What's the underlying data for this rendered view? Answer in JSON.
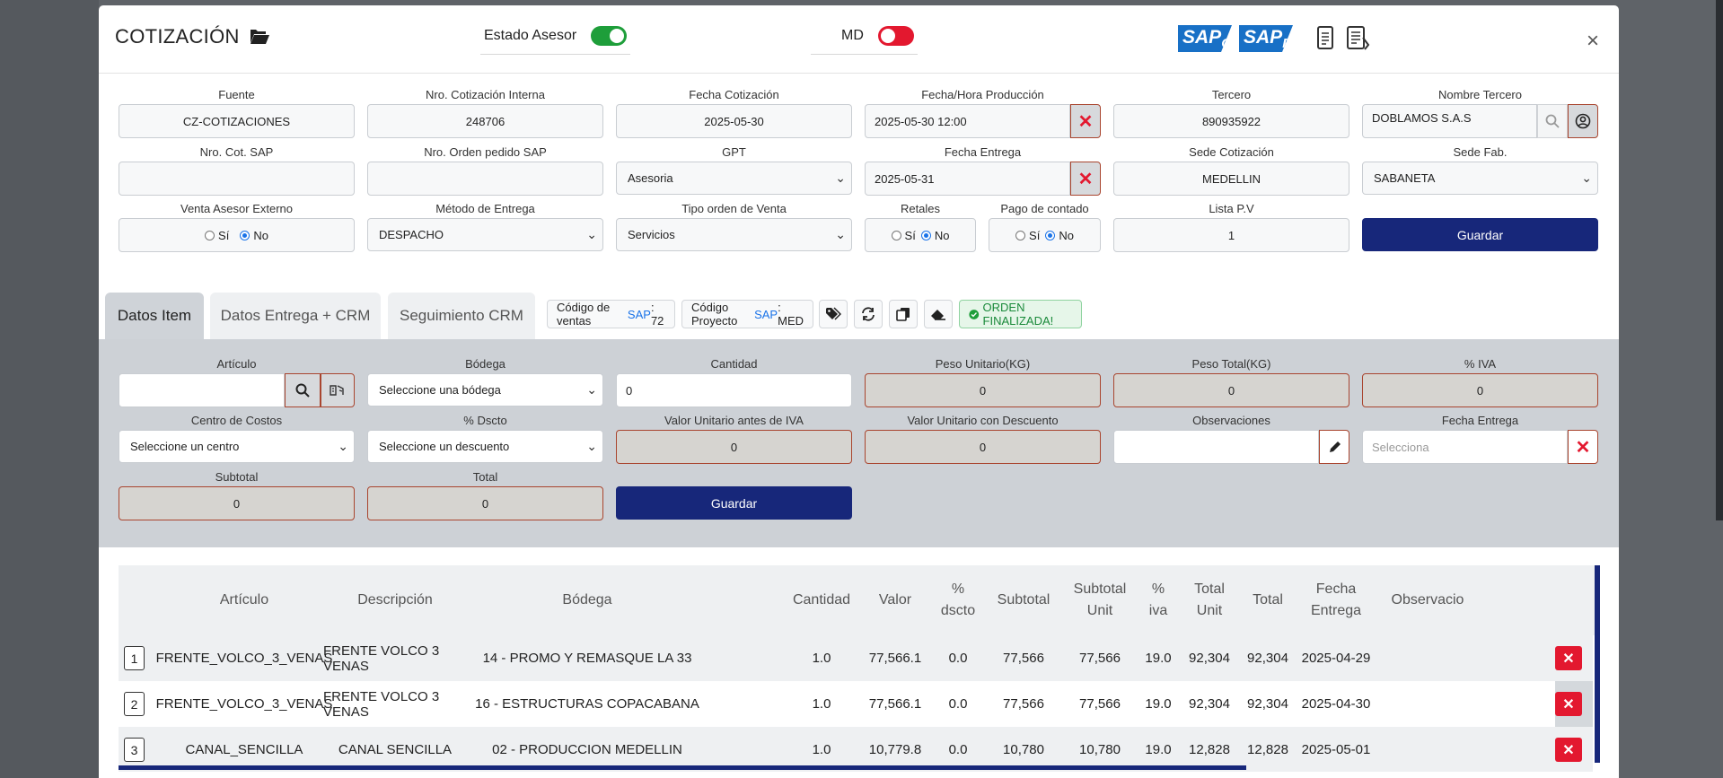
{
  "modal": {
    "title": "COTIZACIÓN",
    "estado_asesor_label": "Estado Asesor",
    "md_label": "MD",
    "close_label": "×"
  },
  "colors": {
    "primary": "#17277a",
    "danger": "#e3182f",
    "success": "#1e9e3a",
    "sap_blue": "#1870c6"
  },
  "form": {
    "fuente": {
      "label": "Fuente",
      "value": "CZ-COTIZACIONES"
    },
    "nro_cot_interna": {
      "label": "Nro. Cotización Interna",
      "value": "248706"
    },
    "fecha_cot": {
      "label": "Fecha Cotización",
      "value": "2025-05-30"
    },
    "fecha_prod": {
      "label": "Fecha/Hora Producción",
      "value": "2025-05-30 12:00"
    },
    "tercero": {
      "label": "Tercero",
      "value": "890935922"
    },
    "nombre_tercero": {
      "label": "Nombre Tercero",
      "value": "DOBLAMOS S.A.S"
    },
    "nro_cot_sap": {
      "label": "Nro. Cot. SAP",
      "value": ""
    },
    "nro_orden_sap": {
      "label": "Nro. Orden pedido SAP",
      "value": ""
    },
    "gpt": {
      "label": "GPT",
      "value": "Asesoria"
    },
    "fecha_entrega": {
      "label": "Fecha Entrega",
      "value": "2025-05-31"
    },
    "sede_cot": {
      "label": "Sede Cotización",
      "value": "MEDELLIN"
    },
    "sede_fab": {
      "label": "Sede Fab.",
      "value": "SABANETA"
    },
    "venta_asesor": {
      "label": "Venta Asesor Externo",
      "si": "Sí",
      "no": "No"
    },
    "metodo_entrega": {
      "label": "Método de Entrega",
      "value": "DESPACHO"
    },
    "tipo_orden": {
      "label": "Tipo orden de Venta",
      "value": "Servicios"
    },
    "retales": {
      "label": "Retales",
      "si": "Sí",
      "no": "No"
    },
    "pago_contado": {
      "label": "Pago de contado",
      "si": "Sí",
      "no": "No"
    },
    "lista_pv": {
      "label": "Lista P.V",
      "value": "1"
    },
    "guardar": "Guardar"
  },
  "tabs": [
    {
      "label": "Datos Item"
    },
    {
      "label": "Datos Entrega + CRM"
    },
    {
      "label": "Seguimiento CRM"
    }
  ],
  "pills": {
    "cod_ventas_prefix": "Código de ventas",
    "cod_ventas_sap": "SAP",
    "cod_ventas_value": ": 72",
    "cod_proy_prefix": "Código Proyecto",
    "cod_proy_sap": "SAP",
    "cod_proy_value": ": MED",
    "orden_finalizada": "ORDEN FINALIZADA!"
  },
  "item": {
    "articulo": {
      "label": "Artículo",
      "value": ""
    },
    "bodega": {
      "label": "Bódega",
      "value": "Seleccione una bódega"
    },
    "cantidad": {
      "label": "Cantidad",
      "value": "0"
    },
    "peso_unit": {
      "label": "Peso Unitario(KG)",
      "value": "0"
    },
    "peso_total": {
      "label": "Peso Total(KG)",
      "value": "0"
    },
    "iva": {
      "label": "% IVA",
      "value": "0"
    },
    "centro_costos": {
      "label": "Centro de Costos",
      "value": "Seleccione un centro"
    },
    "dscto": {
      "label": "% Dscto",
      "value": "Seleccione un descuento"
    },
    "valor_unit": {
      "label": "Valor Unitario antes de IVA",
      "value": "0"
    },
    "valor_unit_desc": {
      "label": "Valor Unitario con Descuento",
      "value": "0"
    },
    "observaciones": {
      "label": "Observaciones",
      "value": ""
    },
    "fecha_entrega": {
      "label": "Fecha Entrega",
      "placeholder": "Selecciona"
    },
    "subtotal": {
      "label": "Subtotal",
      "value": "0"
    },
    "total": {
      "label": "Total",
      "value": "0"
    },
    "guardar": "Guardar"
  },
  "table": {
    "headers": [
      "Artículo",
      "Descripción",
      "Bódega",
      "Cantidad",
      "Valor",
      "% dscto",
      "Subtotal",
      "Subtotal Unit",
      "% iva",
      "Total Unit",
      "Total",
      "Fecha Entrega",
      "Observacio"
    ],
    "rows": [
      {
        "idx": "1",
        "articulo": "FRENTE_VOLCO_3_VENAS",
        "descripcion": "FRENTE VOLCO 3 VENAS",
        "bodega": "14 - PROMO Y REMASQUE LA 33",
        "cantidad": "1.0",
        "valor": "77,566.1",
        "dscto": "0.0",
        "subtotal": "77,566",
        "subtotal_unit": "77,566",
        "iva": "19.0",
        "total_unit": "92,304",
        "total": "92,304",
        "fecha": "2025-04-29",
        "obs": ""
      },
      {
        "idx": "2",
        "articulo": "FRENTE_VOLCO_3_VENAS",
        "descripcion": "FRENTE VOLCO 3 VENAS",
        "bodega": "16 - ESTRUCTURAS COPACABANA",
        "cantidad": "1.0",
        "valor": "77,566.1",
        "dscto": "0.0",
        "subtotal": "77,566",
        "subtotal_unit": "77,566",
        "iva": "19.0",
        "total_unit": "92,304",
        "total": "92,304",
        "fecha": "2025-04-30",
        "obs": ""
      },
      {
        "idx": "3",
        "articulo": "CANAL_SENCILLA",
        "descripcion": "CANAL SENCILLA",
        "bodega": "02 - PRODUCCION MEDELLIN",
        "cantidad": "1.0",
        "valor": "10,779.8",
        "dscto": "0.0",
        "subtotal": "10,780",
        "subtotal_unit": "10,780",
        "iva": "19.0",
        "total_unit": "12,828",
        "total": "12,828",
        "fecha": "2025-05-01",
        "obs": ""
      }
    ],
    "delete_label": "✕"
  }
}
